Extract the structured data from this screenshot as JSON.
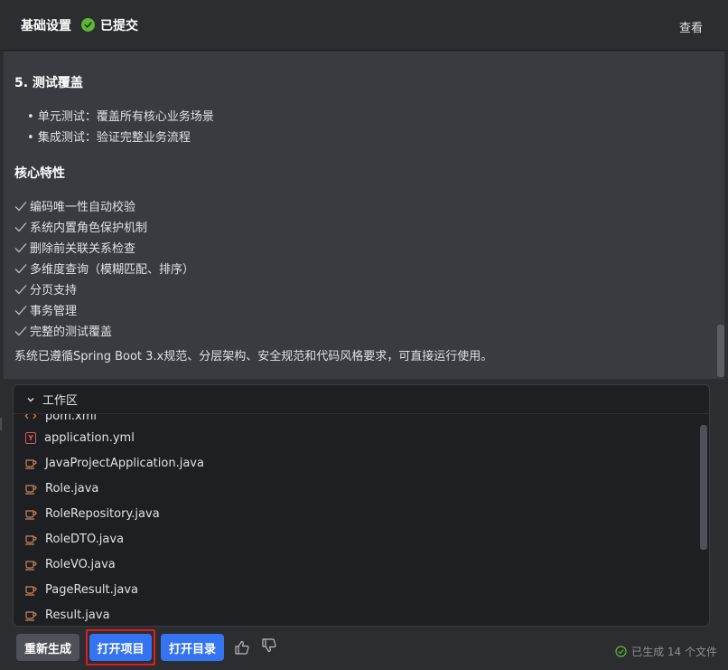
{
  "header": {
    "title": "基础设置",
    "status": "已提交",
    "view_label": "查看"
  },
  "content": {
    "section_test_title": "5. 测试覆盖",
    "test_items": [
      "单元测试：覆盖所有核心业务场景",
      "集成测试：验证完整业务流程"
    ],
    "features_title": "核心特性",
    "features": [
      "编码唯一性自动校验",
      "系统内置角色保护机制",
      "删除前关联关系检查",
      "多维度查询（模糊匹配、排序）",
      "分页支持",
      "事务管理",
      "完整的测试覆盖"
    ],
    "summary": "系统已遵循Spring Boot 3.x规范、分层架构、安全规范和代码风格要求，可直接运行使用。"
  },
  "workspace": {
    "title": "工作区",
    "files": [
      {
        "name": "pom.xml",
        "icon": "xml-icon"
      },
      {
        "name": "application.yml",
        "icon": "yml-icon",
        "badge": "Y"
      },
      {
        "name": "JavaProjectApplication.java",
        "icon": "java-icon"
      },
      {
        "name": "Role.java",
        "icon": "java-icon"
      },
      {
        "name": "RoleRepository.java",
        "icon": "java-icon"
      },
      {
        "name": "RoleDTO.java",
        "icon": "java-icon"
      },
      {
        "name": "RoleVO.java",
        "icon": "java-icon"
      },
      {
        "name": "PageResult.java",
        "icon": "java-icon"
      },
      {
        "name": "Result.java",
        "icon": "java-icon"
      }
    ]
  },
  "footer": {
    "regenerate_label": "重新生成",
    "open_project_label": "打开项目",
    "open_dir_label": "打开目录",
    "generated_status": "已生成 14 个文件"
  },
  "colors": {
    "accent": "#3574f0",
    "success": "#5fb832",
    "highlight": "#e01c24",
    "java_icon": "#c9845a"
  }
}
